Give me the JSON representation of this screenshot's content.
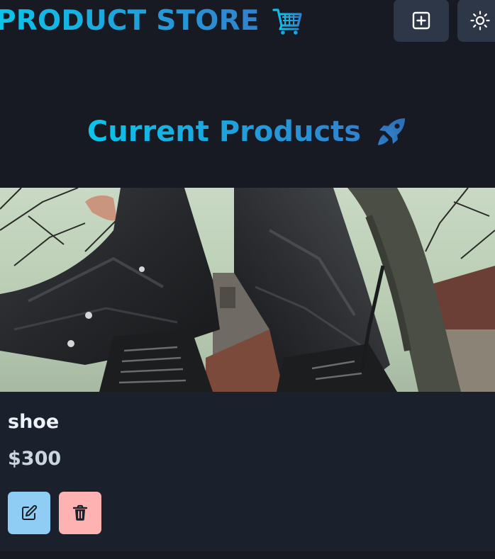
{
  "header": {
    "brand_text": "PRODUCT STORE",
    "brand_icon": "shopping-cart-icon",
    "add_button_icon": "plus-square-icon",
    "theme_button_icon": "sun-icon"
  },
  "main": {
    "section_title": "Current Products",
    "section_icon": "rocket-icon"
  },
  "products": [
    {
      "name": "shoe",
      "price": "$300",
      "image_alt": "person in black boots and trousers under bare trees",
      "edit_icon": "edit-icon",
      "delete_icon": "trash-icon"
    }
  ],
  "colors": {
    "background": "#171923",
    "card": "#1a202c",
    "accent_from": "#0bc5ea",
    "accent_to": "#3182ce",
    "edit_button": "#90cdf4",
    "delete_button": "#feb2b2"
  }
}
